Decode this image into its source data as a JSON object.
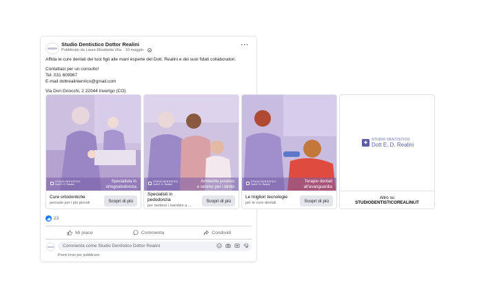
{
  "post": {
    "page_name": "Studio Dentistico Dottor Realini",
    "meta_author": "Pubblicato da Laura Elisabetta Vita",
    "meta_sep": "·",
    "meta_date": "10 maggio",
    "meta_sep2": "·",
    "more_label": "···",
    "text": {
      "line1": "Affida le cure dentali dei tuoi figli alle mani esperte del Dott. Realini e dei suoi fidati collaboratori.",
      "line2": "Contattaci per un consulto!",
      "line3": "Tel. 031 609967",
      "line4": "E-mail dottrealinienrico@gmail.com",
      "line5": "Via Don Gnocchi, 2 22044 Inverigo (CO)"
    }
  },
  "carousel": {
    "overlay_logo_top": "STUDIO DENTISTICO",
    "overlay_logo_bottom": "Dott E. D. Realini",
    "cards": [
      {
        "caption_line1": "Specialista in",
        "caption_line2": "ortognatodonzia",
        "title": "Cure ortodontiche",
        "subtitle": "pensate per i più piccoli",
        "cta": "Scopri di più"
      },
      {
        "caption_line1": "Ambiente positivo",
        "caption_line2": "e sereno per i bimbi",
        "title_line1": "Specialisti in",
        "title_line2": "pedodonzia",
        "subtitle": "per mettere i bambini a ...",
        "cta": "Scopri di più"
      },
      {
        "caption_line1": "Terapie dentali",
        "caption_line2": "all'avanguardia",
        "title": "Le migliori tecnologie",
        "subtitle": "per le cure dentali",
        "cta": "Scopri di più"
      }
    ],
    "brand_card": {
      "logo_mark": "✚",
      "logo_top": "STUDIO DENTISTICO",
      "logo_bottom": "Dott E. D. Realini",
      "footer_line1": "Altro su",
      "footer_line2": "STUDIODENTISTICOREALINI.IT"
    }
  },
  "reactions": {
    "count": "23"
  },
  "actions": {
    "like": "Mi piace",
    "comment": "Commenta",
    "share": "Condividi"
  },
  "comment": {
    "placeholder": "Commenta come Studio Dentistico Dottor Realini",
    "send_hint": "Premi Invio per pubblicare."
  },
  "colors": {
    "accent": "#1877f2",
    "brand_purple": "#5b5ea6",
    "overlay": "#765ca5"
  },
  "icons": [
    "globe-icon",
    "more-icon",
    "like-badge-icon",
    "thumbs-up-icon",
    "comment-icon",
    "share-icon",
    "emoji-icon",
    "camera-icon",
    "gif-icon",
    "sticker-icon"
  ]
}
